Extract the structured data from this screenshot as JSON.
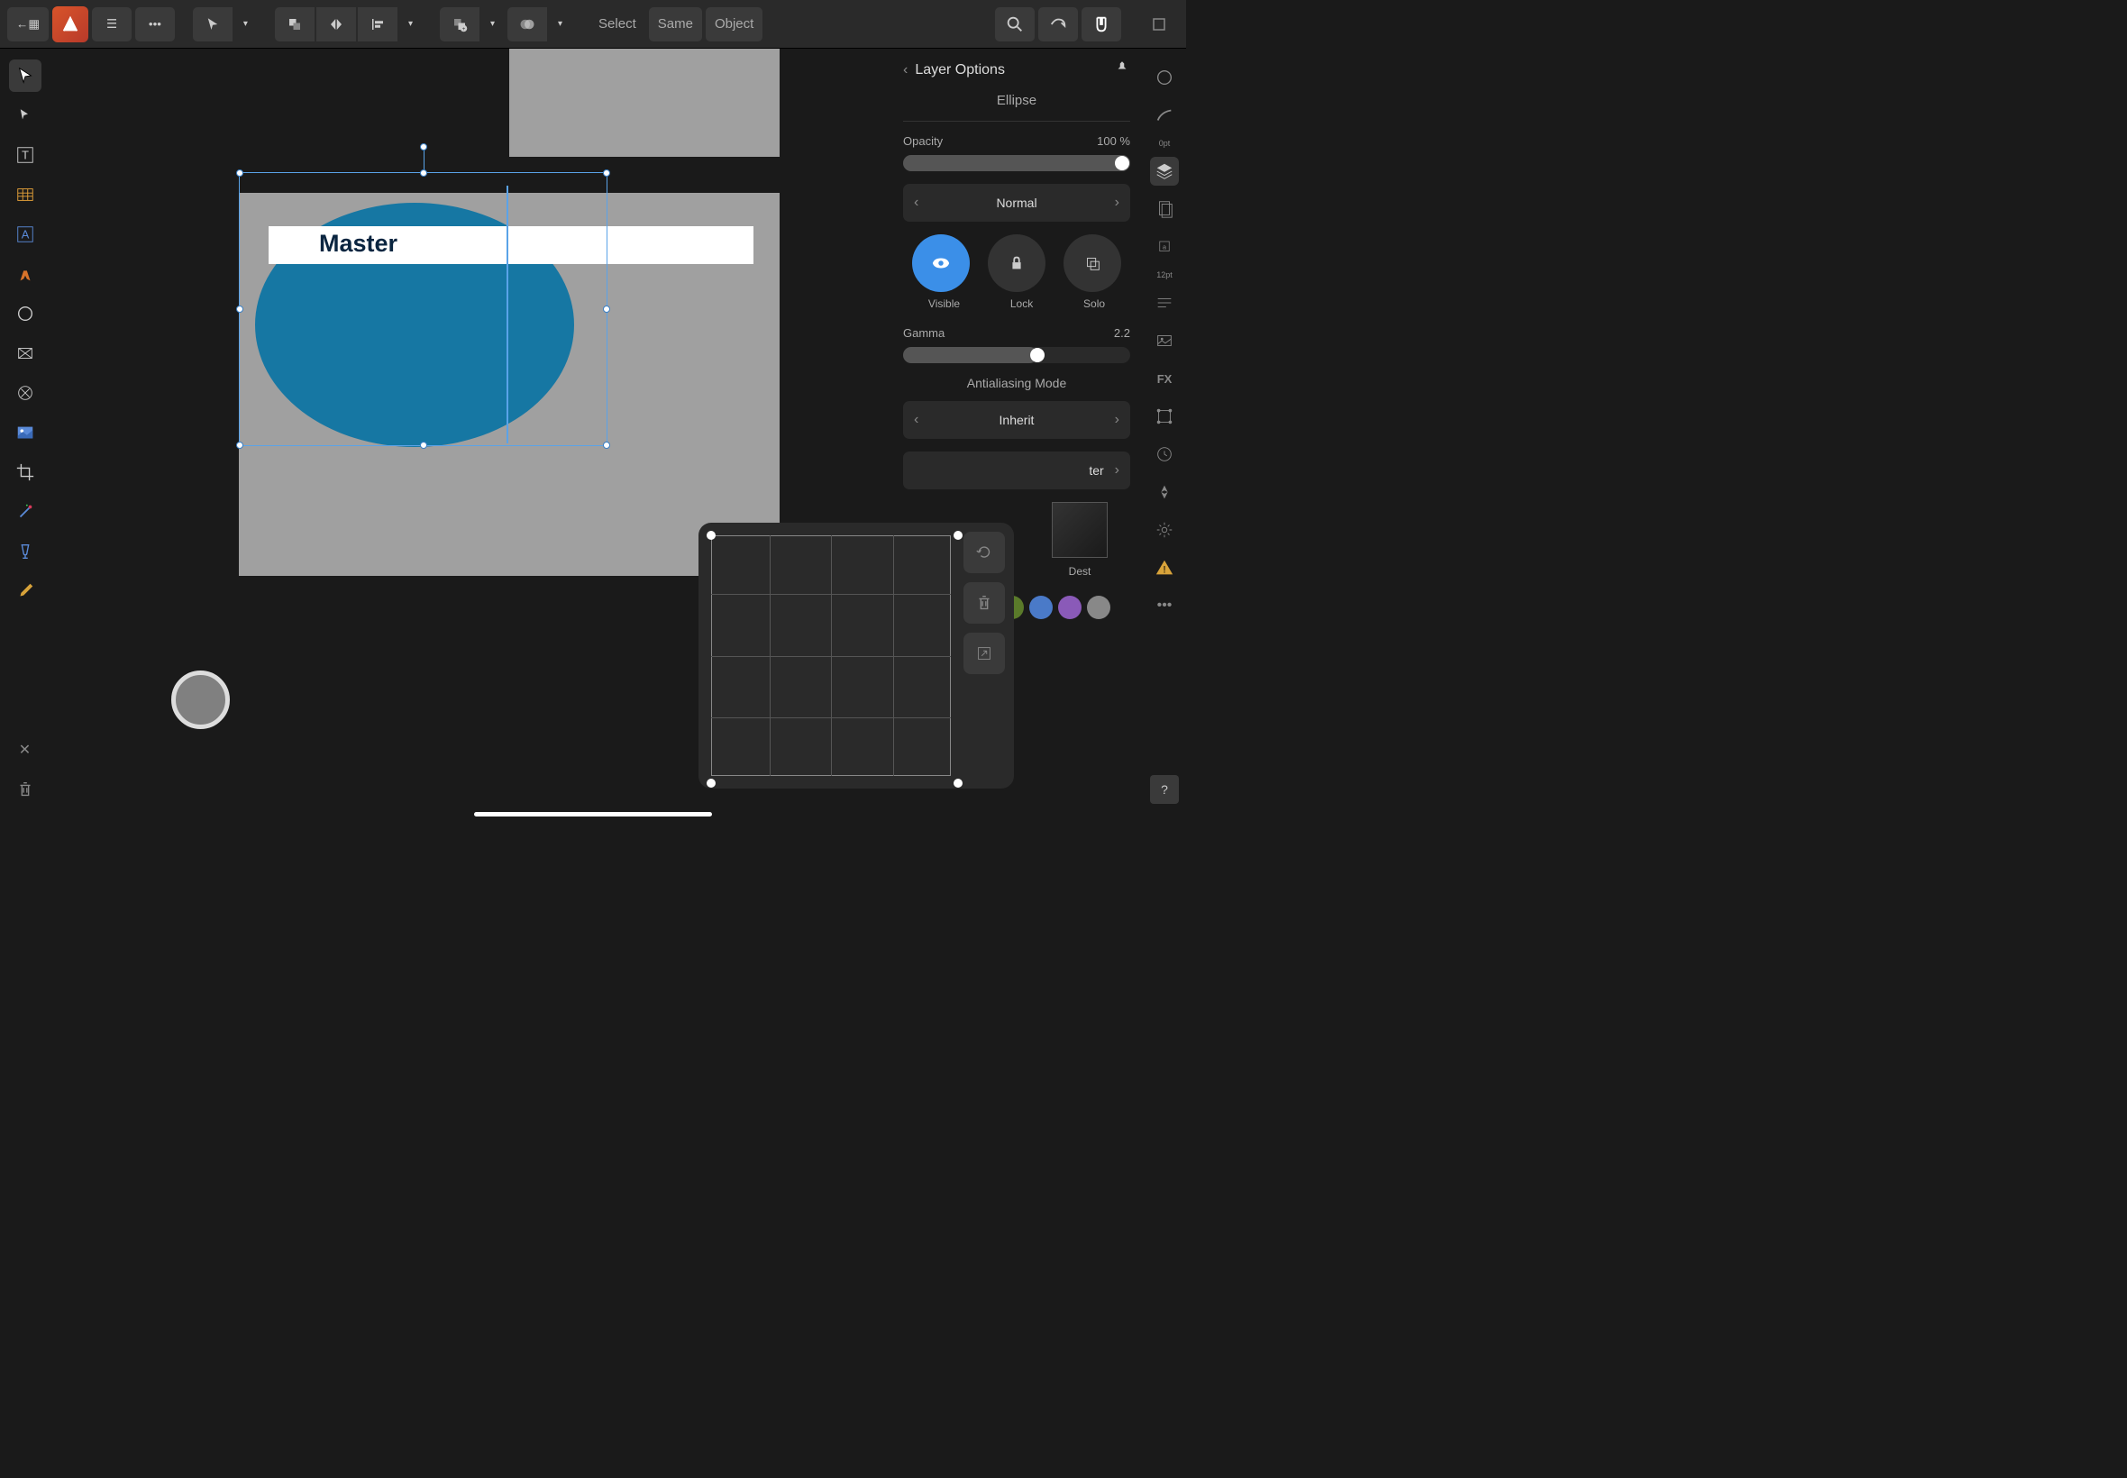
{
  "topToolbar": {
    "selectLabel": "Select",
    "sameLabel": "Same",
    "objectLabel": "Object"
  },
  "canvas": {
    "masterText": "Master"
  },
  "panel": {
    "title": "Layer Options",
    "shapeName": "Ellipse",
    "opacityLabel": "Opacity",
    "opacityValue": "100 %",
    "blendMode": "Normal",
    "visibleLabel": "Visible",
    "lockLabel": "Lock",
    "soloLabel": "Solo",
    "gammaLabel": "Gamma",
    "gammaValue": "2.2",
    "antialiasTitle": "Antialiasing Mode",
    "antialiasMode": "Inherit",
    "terLabel": "ter",
    "destLabel": "Dest"
  },
  "rightToolbar": {
    "strokeLabel": "0pt",
    "charLabel": "12pt"
  },
  "colors": {
    "green": "#5a7a2a",
    "blue": "#4a7ac8",
    "purple": "#8a5ab8",
    "gray": "#888888"
  }
}
